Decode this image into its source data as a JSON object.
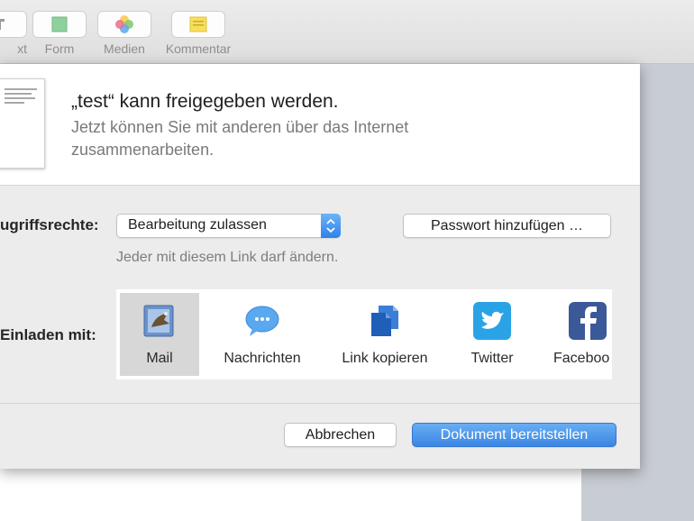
{
  "toolbar": {
    "items": [
      {
        "label": "xt",
        "icon": "text-icon"
      },
      {
        "label": "Form",
        "icon": "shape-icon"
      },
      {
        "label": "Medien",
        "icon": "media-icon"
      },
      {
        "label": "Kommentar",
        "icon": "comment-icon"
      }
    ]
  },
  "sheet": {
    "title": "„test“ kann freigegeben werden.",
    "description": "Jetzt können Sie mit anderen über das Internet zusammenarbeiten.",
    "permissions_label": "ugriffsrechte:",
    "permission_value": "Bearbeitung zulassen",
    "password_button": "Passwort hinzufügen …",
    "hint": "Jeder mit diesem Link darf ändern.",
    "invite_label": "Einladen mit:",
    "share_options": [
      {
        "label": "Mail",
        "icon": "mail-icon",
        "selected": true
      },
      {
        "label": "Nachrichten",
        "icon": "messages-icon",
        "selected": false
      },
      {
        "label": "Link kopieren",
        "icon": "copy-link-icon",
        "selected": false
      },
      {
        "label": "Twitter",
        "icon": "twitter-icon",
        "selected": false
      },
      {
        "label": "Faceboo",
        "icon": "facebook-icon",
        "selected": false
      }
    ],
    "cancel_button": "Abbrechen",
    "confirm_button": "Dokument bereitstellen"
  },
  "colors": {
    "accent": "#3b85e2",
    "twitter": "#2aa3e6",
    "facebook": "#3b5998"
  }
}
